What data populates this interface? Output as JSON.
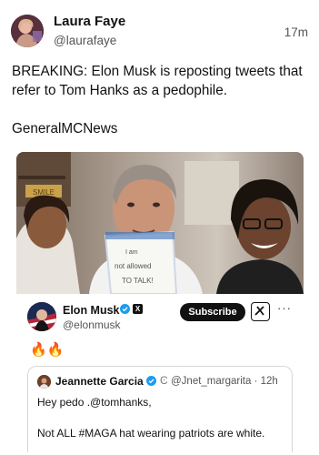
{
  "post": {
    "author_name": "Laura Faye",
    "author_handle": "@laurafaye",
    "timestamp": "17m",
    "text": "BREAKING: Elon Musk is reposting tweets that refer to Tom Hanks as a pedophile.\n\nGeneralMCNews"
  },
  "photo": {
    "sign_text_1": "I am",
    "sign_text_2": "not allowed",
    "sign_text_3": "TO TALK!",
    "shelf_sign": "SMILE"
  },
  "embed": {
    "author_name": "Elon Musk",
    "author_handle": "@elonmusk",
    "subscribe_label": "Subscribe",
    "more_label": "···",
    "reaction": "🔥🔥",
    "quote": {
      "author_name": "Jeannette Garcia",
      "badge_c": "Ͼ",
      "handle_time": "@Jnet_margarita · 12h",
      "line1": "Hey pedo .@tomhanks,",
      "line2": "Not ALL #MAGA hat wearing patriots are white."
    }
  },
  "colors": {
    "verified_blue": "#1d9bf0",
    "text_primary": "#111111",
    "text_secondary": "#555555"
  }
}
